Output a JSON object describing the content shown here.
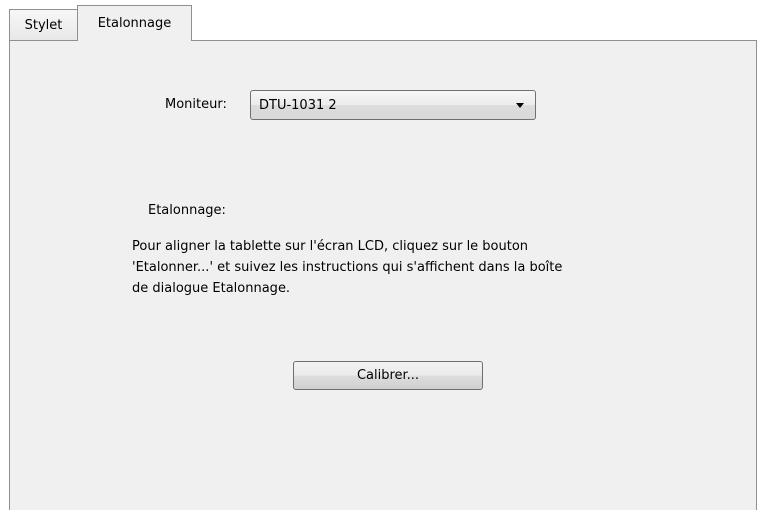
{
  "tabs": [
    {
      "label": "Stylet",
      "selected": false
    },
    {
      "label": "Etalonnage",
      "selected": true
    }
  ],
  "monitor": {
    "label": "Moniteur:",
    "selected_value": "DTU-1031 2"
  },
  "calibration": {
    "section_title": "Etalonnage:",
    "description_lines": [
      "Pour aligner la tablette sur l'écran LCD, cliquez sur le bouton",
      "'Etalonner...' et suivez les instructions qui s'affichent dans la boîte",
      "de dialogue Etalonnage."
    ],
    "button_label": "Calibrer..."
  },
  "colors": {
    "panel_background": "#f0f0f0",
    "border": "#8e8f8f"
  },
  "icons": {
    "dropdown": "chevron-down-icon"
  }
}
